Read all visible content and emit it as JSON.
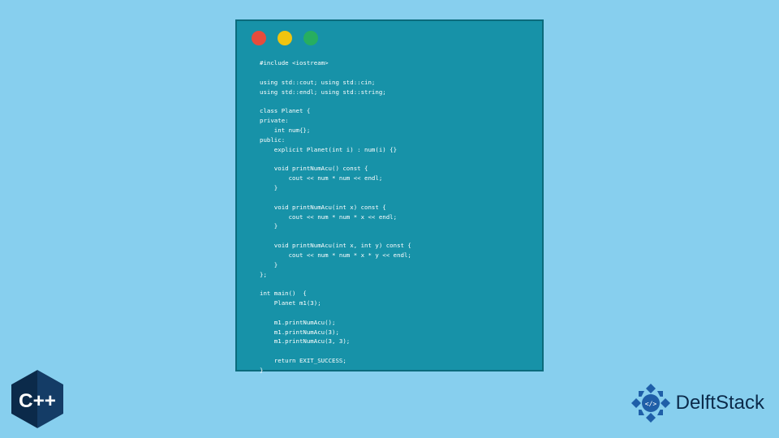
{
  "traffic_lights": {
    "red": "#e74c3c",
    "yellow": "#f1c40f",
    "green": "#27ae60"
  },
  "code": "#include <iostream>\n\nusing std::cout; using std::cin;\nusing std::endl; using std::string;\n\nclass Planet {\nprivate:\n    int num{};\npublic:\n    explicit Planet(int i) : num(i) {}\n\n    void printNumAcu() const {\n        cout << num * num << endl;\n    }\n\n    void printNumAcu(int x) const {\n        cout << num * num * x << endl;\n    }\n\n    void printNumAcu(int x, int y) const {\n        cout << num * num * x * y << endl;\n    }\n};\n\nint main()  {\n    Planet m1(3);\n\n    m1.printNumAcu();\n    m1.printNumAcu(3);\n    m1.printNumAcu(3, 3);\n\n    return EXIT_SUCCESS;\n}",
  "cpp_badge": {
    "label": "C++"
  },
  "delftstack": {
    "text": "DelftStack"
  }
}
